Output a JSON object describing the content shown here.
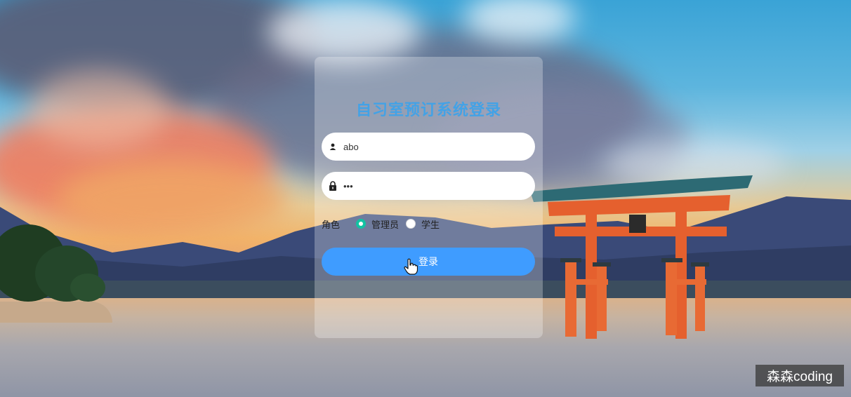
{
  "login": {
    "title": "自习室预订系统登录",
    "username_value": "abo",
    "password_value": "•••",
    "role_label": "角色",
    "role_options": [
      {
        "label": "管理员",
        "checked": true
      },
      {
        "label": "学生",
        "checked": false
      }
    ],
    "submit_label": "登录"
  },
  "watermark": "森森coding",
  "colors": {
    "title": "#43a2e6",
    "button": "#3f9cff",
    "radio_checked": "#13c2a2"
  },
  "icons": {
    "username": "user-icon",
    "password": "lock-icon",
    "cursor": "hand-pointer-icon"
  }
}
